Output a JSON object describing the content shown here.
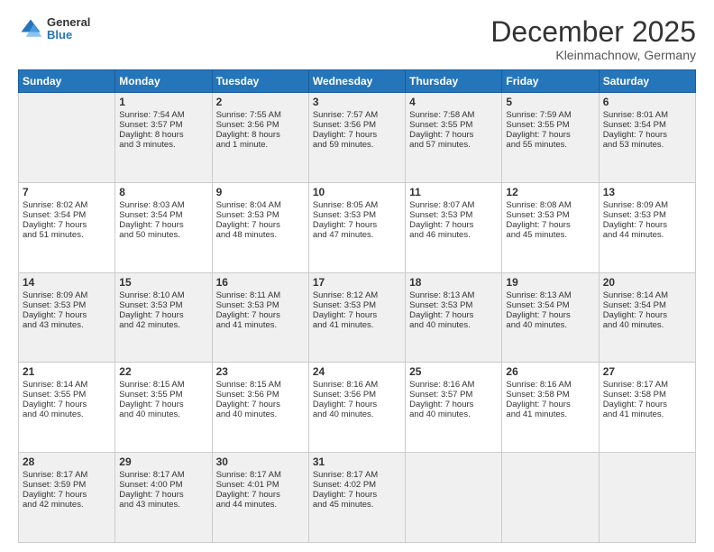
{
  "logo": {
    "general": "General",
    "blue": "Blue"
  },
  "header": {
    "month": "December 2025",
    "location": "Kleinmachnow, Germany"
  },
  "weekdays": [
    "Sunday",
    "Monday",
    "Tuesday",
    "Wednesday",
    "Thursday",
    "Friday",
    "Saturday"
  ],
  "weeks": [
    [
      {
        "day": "",
        "lines": []
      },
      {
        "day": "1",
        "lines": [
          "Sunrise: 7:54 AM",
          "Sunset: 3:57 PM",
          "Daylight: 8 hours",
          "and 3 minutes."
        ]
      },
      {
        "day": "2",
        "lines": [
          "Sunrise: 7:55 AM",
          "Sunset: 3:56 PM",
          "Daylight: 8 hours",
          "and 1 minute."
        ]
      },
      {
        "day": "3",
        "lines": [
          "Sunrise: 7:57 AM",
          "Sunset: 3:56 PM",
          "Daylight: 7 hours",
          "and 59 minutes."
        ]
      },
      {
        "day": "4",
        "lines": [
          "Sunrise: 7:58 AM",
          "Sunset: 3:55 PM",
          "Daylight: 7 hours",
          "and 57 minutes."
        ]
      },
      {
        "day": "5",
        "lines": [
          "Sunrise: 7:59 AM",
          "Sunset: 3:55 PM",
          "Daylight: 7 hours",
          "and 55 minutes."
        ]
      },
      {
        "day": "6",
        "lines": [
          "Sunrise: 8:01 AM",
          "Sunset: 3:54 PM",
          "Daylight: 7 hours",
          "and 53 minutes."
        ]
      }
    ],
    [
      {
        "day": "7",
        "lines": [
          "Sunrise: 8:02 AM",
          "Sunset: 3:54 PM",
          "Daylight: 7 hours",
          "and 51 minutes."
        ]
      },
      {
        "day": "8",
        "lines": [
          "Sunrise: 8:03 AM",
          "Sunset: 3:54 PM",
          "Daylight: 7 hours",
          "and 50 minutes."
        ]
      },
      {
        "day": "9",
        "lines": [
          "Sunrise: 8:04 AM",
          "Sunset: 3:53 PM",
          "Daylight: 7 hours",
          "and 48 minutes."
        ]
      },
      {
        "day": "10",
        "lines": [
          "Sunrise: 8:05 AM",
          "Sunset: 3:53 PM",
          "Daylight: 7 hours",
          "and 47 minutes."
        ]
      },
      {
        "day": "11",
        "lines": [
          "Sunrise: 8:07 AM",
          "Sunset: 3:53 PM",
          "Daylight: 7 hours",
          "and 46 minutes."
        ]
      },
      {
        "day": "12",
        "lines": [
          "Sunrise: 8:08 AM",
          "Sunset: 3:53 PM",
          "Daylight: 7 hours",
          "and 45 minutes."
        ]
      },
      {
        "day": "13",
        "lines": [
          "Sunrise: 8:09 AM",
          "Sunset: 3:53 PM",
          "Daylight: 7 hours",
          "and 44 minutes."
        ]
      }
    ],
    [
      {
        "day": "14",
        "lines": [
          "Sunrise: 8:09 AM",
          "Sunset: 3:53 PM",
          "Daylight: 7 hours",
          "and 43 minutes."
        ]
      },
      {
        "day": "15",
        "lines": [
          "Sunrise: 8:10 AM",
          "Sunset: 3:53 PM",
          "Daylight: 7 hours",
          "and 42 minutes."
        ]
      },
      {
        "day": "16",
        "lines": [
          "Sunrise: 8:11 AM",
          "Sunset: 3:53 PM",
          "Daylight: 7 hours",
          "and 41 minutes."
        ]
      },
      {
        "day": "17",
        "lines": [
          "Sunrise: 8:12 AM",
          "Sunset: 3:53 PM",
          "Daylight: 7 hours",
          "and 41 minutes."
        ]
      },
      {
        "day": "18",
        "lines": [
          "Sunrise: 8:13 AM",
          "Sunset: 3:53 PM",
          "Daylight: 7 hours",
          "and 40 minutes."
        ]
      },
      {
        "day": "19",
        "lines": [
          "Sunrise: 8:13 AM",
          "Sunset: 3:54 PM",
          "Daylight: 7 hours",
          "and 40 minutes."
        ]
      },
      {
        "day": "20",
        "lines": [
          "Sunrise: 8:14 AM",
          "Sunset: 3:54 PM",
          "Daylight: 7 hours",
          "and 40 minutes."
        ]
      }
    ],
    [
      {
        "day": "21",
        "lines": [
          "Sunrise: 8:14 AM",
          "Sunset: 3:55 PM",
          "Daylight: 7 hours",
          "and 40 minutes."
        ]
      },
      {
        "day": "22",
        "lines": [
          "Sunrise: 8:15 AM",
          "Sunset: 3:55 PM",
          "Daylight: 7 hours",
          "and 40 minutes."
        ]
      },
      {
        "day": "23",
        "lines": [
          "Sunrise: 8:15 AM",
          "Sunset: 3:56 PM",
          "Daylight: 7 hours",
          "and 40 minutes."
        ]
      },
      {
        "day": "24",
        "lines": [
          "Sunrise: 8:16 AM",
          "Sunset: 3:56 PM",
          "Daylight: 7 hours",
          "and 40 minutes."
        ]
      },
      {
        "day": "25",
        "lines": [
          "Sunrise: 8:16 AM",
          "Sunset: 3:57 PM",
          "Daylight: 7 hours",
          "and 40 minutes."
        ]
      },
      {
        "day": "26",
        "lines": [
          "Sunrise: 8:16 AM",
          "Sunset: 3:58 PM",
          "Daylight: 7 hours",
          "and 41 minutes."
        ]
      },
      {
        "day": "27",
        "lines": [
          "Sunrise: 8:17 AM",
          "Sunset: 3:58 PM",
          "Daylight: 7 hours",
          "and 41 minutes."
        ]
      }
    ],
    [
      {
        "day": "28",
        "lines": [
          "Sunrise: 8:17 AM",
          "Sunset: 3:59 PM",
          "Daylight: 7 hours",
          "and 42 minutes."
        ]
      },
      {
        "day": "29",
        "lines": [
          "Sunrise: 8:17 AM",
          "Sunset: 4:00 PM",
          "Daylight: 7 hours",
          "and 43 minutes."
        ]
      },
      {
        "day": "30",
        "lines": [
          "Sunrise: 8:17 AM",
          "Sunset: 4:01 PM",
          "Daylight: 7 hours",
          "and 44 minutes."
        ]
      },
      {
        "day": "31",
        "lines": [
          "Sunrise: 8:17 AM",
          "Sunset: 4:02 PM",
          "Daylight: 7 hours",
          "and 45 minutes."
        ]
      },
      {
        "day": "",
        "lines": []
      },
      {
        "day": "",
        "lines": []
      },
      {
        "day": "",
        "lines": []
      }
    ]
  ]
}
